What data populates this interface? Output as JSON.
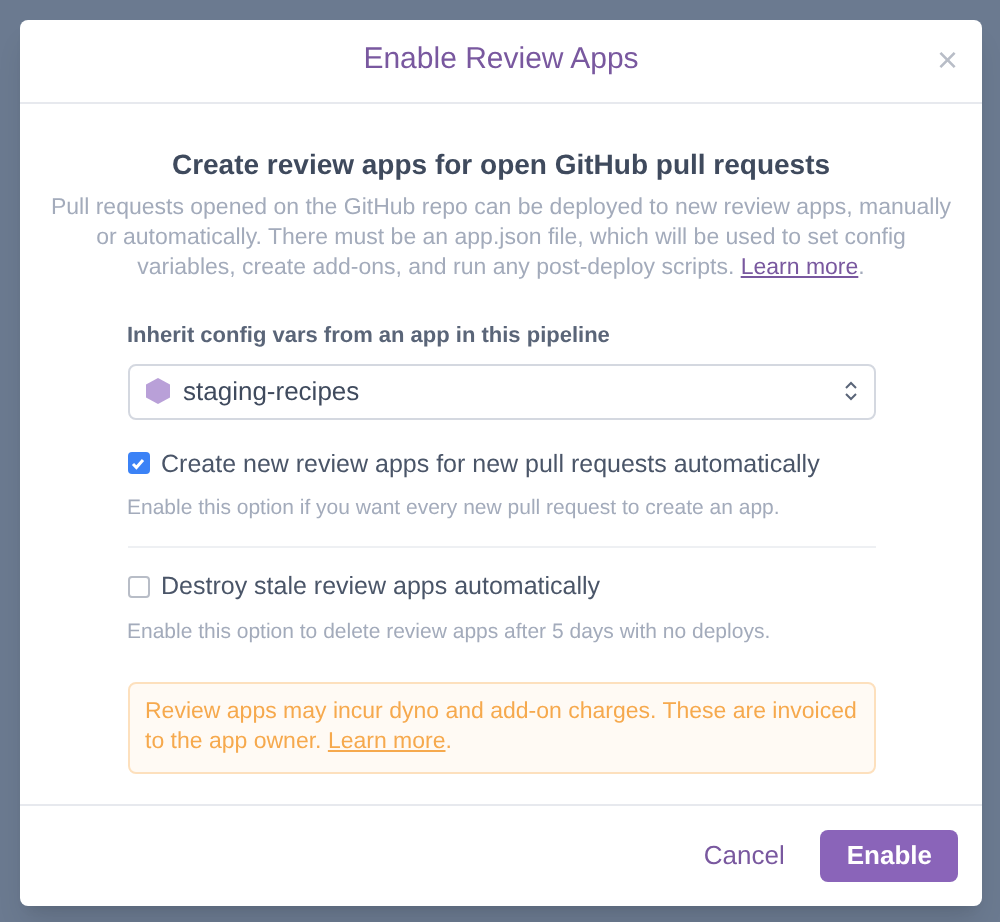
{
  "dialog": {
    "title": "Enable Review Apps",
    "close": "×"
  },
  "intro": {
    "heading": "Create review apps for open GitHub pull requests",
    "text": "Pull requests opened on the GitHub repo can be deployed to new review apps, manually or automatically. There must be an app.json file, which will be used to set config variables, create add-ons, and run any post-deploy scripts. ",
    "link": "Learn more",
    "after": "."
  },
  "inherit": {
    "label": "Inherit config vars from an app in this pipeline",
    "value": "staging-recipes"
  },
  "options": [
    {
      "label": "Create new review apps for new pull requests automatically",
      "checked": true,
      "hint": "Enable this option if you want every new pull request to create an app."
    },
    {
      "label": "Destroy stale review apps automatically",
      "checked": false,
      "hint": "Enable this option to delete review apps after 5 days with no deploys."
    }
  ],
  "warning": {
    "text": "Review apps may incur dyno and add-on charges. These are invoiced to the app owner. ",
    "link": "Learn more",
    "after": "."
  },
  "buttons": [
    {
      "label": "Cancel",
      "kind": "link"
    },
    {
      "label": "Enable",
      "kind": "primary"
    }
  ]
}
